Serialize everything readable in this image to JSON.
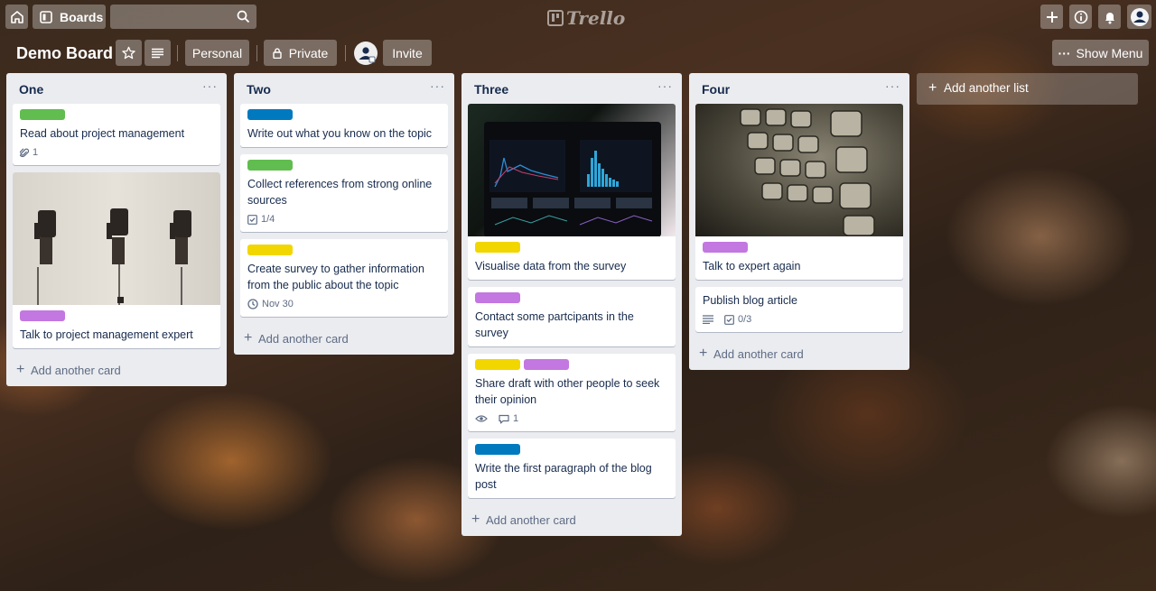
{
  "header": {
    "boards_label": "Boards",
    "search_placeholder": "",
    "logo_text": "Trello"
  },
  "board": {
    "title": "Demo Board",
    "team_label": "Personal",
    "visibility_label": "Private",
    "invite_label": "Invite",
    "show_menu_label": "Show Menu"
  },
  "colors": {
    "label_green": "#61bd4f",
    "label_blue": "#0079bf",
    "label_yellow": "#f2d600",
    "label_purple": "#c377e0"
  },
  "lists": [
    {
      "title": "One",
      "menu": "···",
      "cards": [
        {
          "title": "Read about project management",
          "attachments": "1"
        },
        {
          "title": "Talk to project management expert"
        }
      ],
      "add_card": "Add another card"
    },
    {
      "title": "Two",
      "menu": "···",
      "cards": [
        {
          "title": "Write out what you know on the topic"
        },
        {
          "title": "Collect references from strong online sources",
          "checklist": "1/4"
        },
        {
          "title": "Create survey to gather information from the public about the topic",
          "due": "Nov 30"
        }
      ],
      "add_card": "Add another card"
    },
    {
      "title": "Three",
      "menu": "···",
      "cards": [
        {
          "title": "Visualise data from the survey"
        },
        {
          "title": "Contact some partcipants in the survey"
        },
        {
          "title": "Share draft with other people to seek their opinion",
          "comments": "1"
        },
        {
          "title": "Write the first paragraph of the blog post"
        }
      ],
      "add_card": "Add another card"
    },
    {
      "title": "Four",
      "menu": "···",
      "cards": [
        {
          "title": "Talk to expert again"
        },
        {
          "title": "Publish blog article",
          "checklist": "0/3"
        }
      ],
      "add_card": "Add another card"
    }
  ],
  "add_list": "Add another list"
}
